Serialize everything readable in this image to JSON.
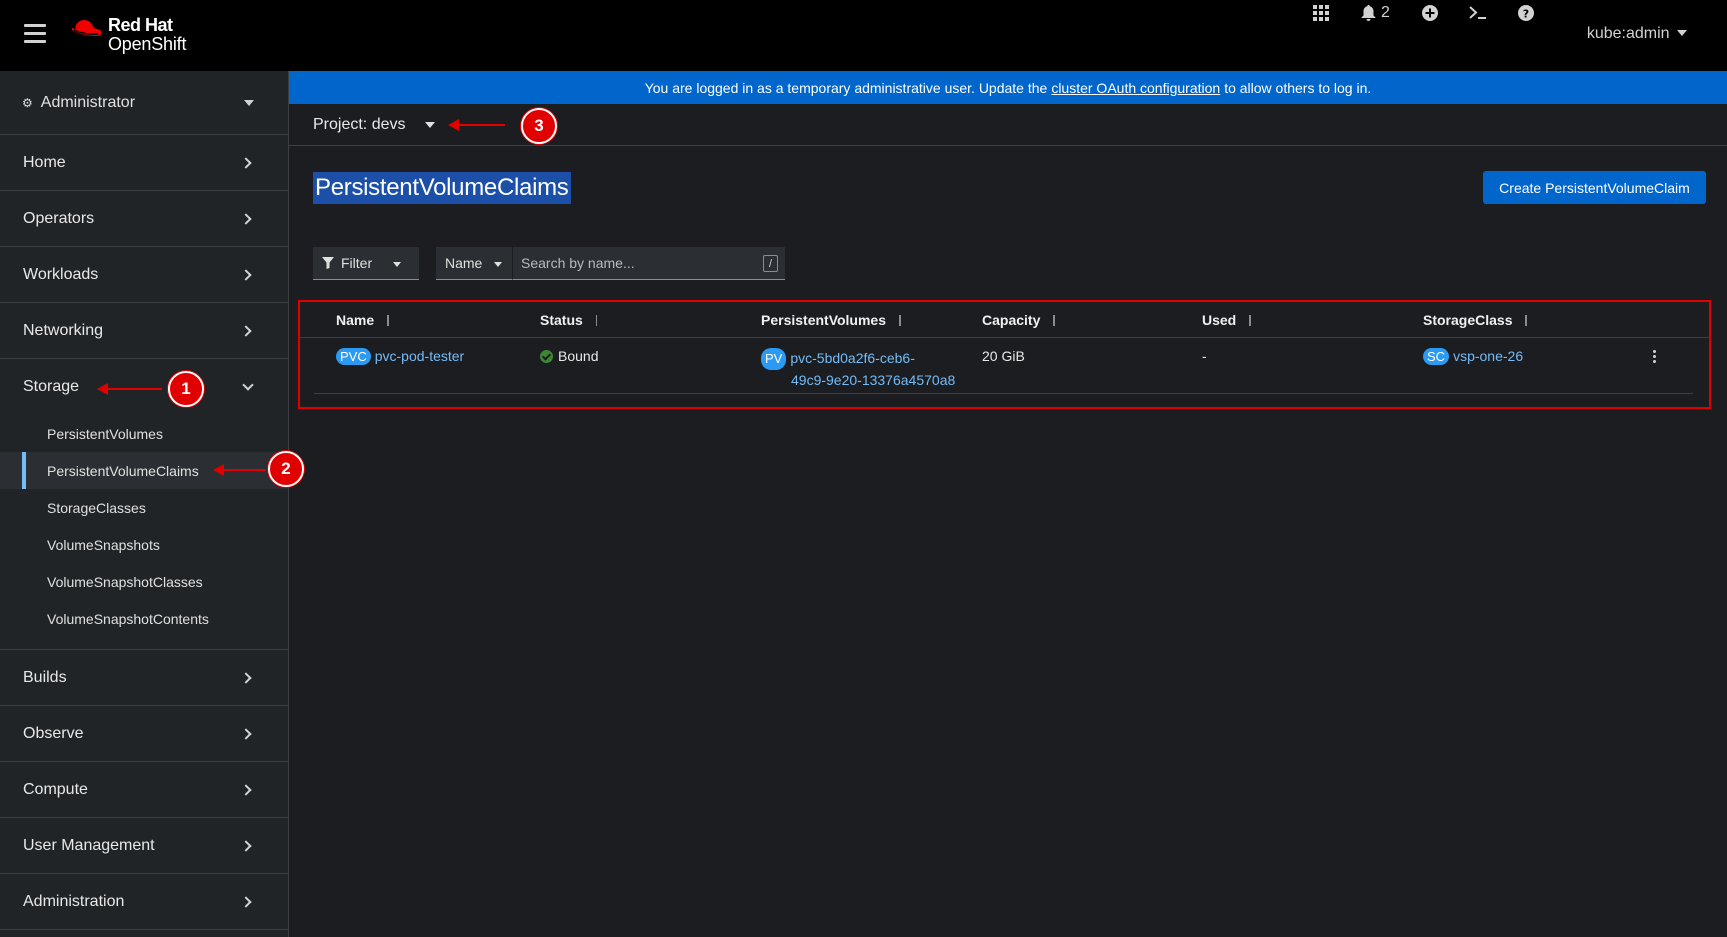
{
  "masthead": {
    "brand_line1": "Red Hat",
    "brand_line2": "OpenShift",
    "notification_count": "2",
    "user": "kube:admin"
  },
  "sidebar": {
    "perspective": "Administrator",
    "items": [
      {
        "label": "Home"
      },
      {
        "label": "Operators"
      },
      {
        "label": "Workloads"
      },
      {
        "label": "Networking"
      },
      {
        "label": "Storage"
      },
      {
        "label": "Builds"
      },
      {
        "label": "Observe"
      },
      {
        "label": "Compute"
      },
      {
        "label": "User Management"
      },
      {
        "label": "Administration"
      }
    ],
    "storage_sub": [
      {
        "label": "PersistentVolumes"
      },
      {
        "label": "PersistentVolumeClaims"
      },
      {
        "label": "StorageClasses"
      },
      {
        "label": "VolumeSnapshots"
      },
      {
        "label": "VolumeSnapshotClasses"
      },
      {
        "label": "VolumeSnapshotContents"
      }
    ]
  },
  "banner": {
    "text_before": "You are logged in as a temporary administrative user. Update the",
    "link": "cluster OAuth configuration",
    "text_after": "to allow others to log in."
  },
  "project": {
    "label": "Project: devs"
  },
  "page": {
    "title": "PersistentVolumeClaims",
    "create_button": "Create PersistentVolumeClaim"
  },
  "filter": {
    "filter_label": "Filter",
    "name_label": "Name",
    "search_placeholder": "Search by name...",
    "slash": "/"
  },
  "table": {
    "columns": [
      "Name",
      "Status",
      "PersistentVolumes",
      "Capacity",
      "Used",
      "StorageClass"
    ],
    "rows": [
      {
        "name_badge": "PVC",
        "name": "pvc-pod-tester",
        "status": "Bound",
        "pv_badge": "PV",
        "pv_line1": "pvc-5bd0a2f6-ceb6-",
        "pv_line2": "49c9-9e20-13376a4570a8",
        "capacity": "20 GiB",
        "used": "-",
        "sc_badge": "SC",
        "storage_class": "vsp-one-26"
      }
    ]
  },
  "annotations": [
    "1",
    "2",
    "3"
  ],
  "colors": {
    "accent": "#0066cc",
    "annotation": "#e00000",
    "link": "#73bcf7",
    "status_ok": "#3e8635"
  }
}
